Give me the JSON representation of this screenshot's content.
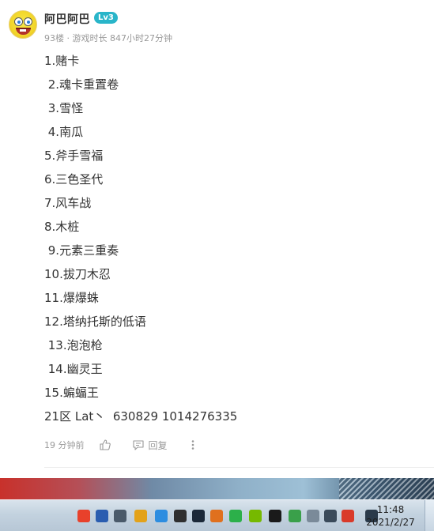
{
  "post": {
    "username": "阿巴阿巴",
    "level": "Lv3",
    "meta": "93楼 · 游戏时长 847小时27分钟",
    "lines": [
      "1.赌卡",
      " 2.魂卡重置卷",
      " 3.雪怪",
      " 4.南瓜",
      "5.斧手雪福",
      "6.三色圣代",
      "7.风车战",
      "8.木桩",
      " 9.元素三重奏",
      "10.拔刀木忍",
      "11.爆爆蛛",
      "12.塔纳托斯的低语",
      " 13.泡泡枪",
      " 14.幽灵王",
      "15.蝙蝠王",
      "21区 Lat丶  630829 1014276335"
    ],
    "time_ago": "19 分钟前",
    "reply_label": "回复",
    "like_icon": "thumbs-up-icon",
    "reply_icon": "comment-icon",
    "more_icon": "more-vertical-icon"
  },
  "taskbar": {
    "time": "11:48",
    "date": "2021/2/27",
    "icons": [
      {
        "name": "sogou-input-icon",
        "color": "#e8412b"
      },
      {
        "name": "help-icon",
        "color": "#2a5db0"
      },
      {
        "name": "language-bar-icon",
        "color": "#4a5a6a"
      },
      {
        "name": "g-app-icon",
        "color": "#e3a21a"
      },
      {
        "name": "shield-icon",
        "color": "#2d8de0"
      },
      {
        "name": "grid-app-icon",
        "color": "#2f2f2f"
      },
      {
        "name": "steam-icon",
        "color": "#1b2838"
      },
      {
        "name": "folder-app-icon",
        "color": "#e0701e"
      },
      {
        "name": "wechat-icon",
        "color": "#2cb04a"
      },
      {
        "name": "nvidia-icon",
        "color": "#76b900"
      },
      {
        "name": "qq-icon",
        "color": "#1a1a1a"
      },
      {
        "name": "security-check-icon",
        "color": "#3aa04a"
      },
      {
        "name": "notes-icon",
        "color": "#7a8a99"
      },
      {
        "name": "volume-icon",
        "color": "#3a4a5a"
      },
      {
        "name": "speaker-warning-icon",
        "color": "#d93a2a"
      },
      {
        "name": "network-icon",
        "color": "#2a3a4a"
      }
    ]
  }
}
